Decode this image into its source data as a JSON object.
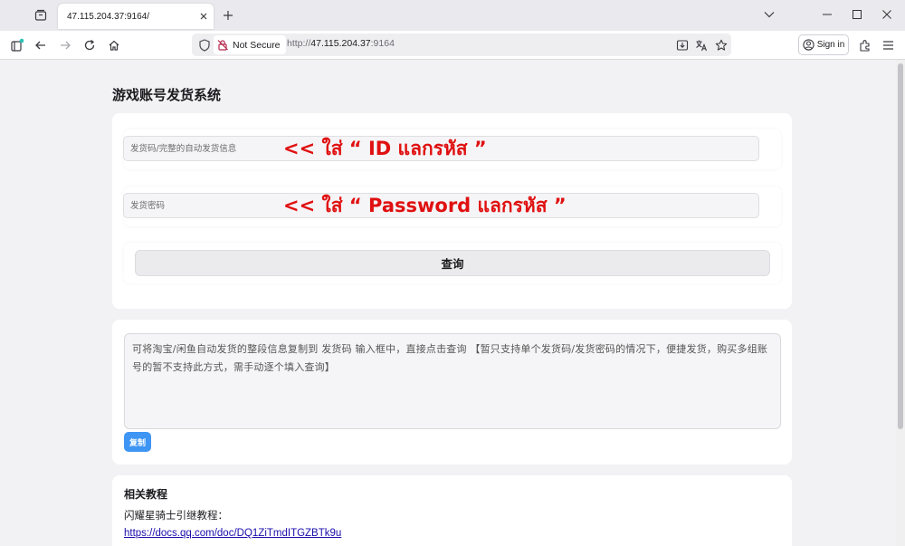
{
  "browser": {
    "tab_title": "47.115.204.37:9164/",
    "security_label": "Not Secure",
    "url_scheme": "http://",
    "url_host": "47.115.204.37",
    "url_port": ":9164",
    "signin_label": "Sign in"
  },
  "icons": {
    "tab_list": "tab-list-icon",
    "tab_close": "close-icon",
    "new_tab": "plus-icon",
    "minimize": "minimize-icon",
    "maximize": "maximize-icon",
    "window_close": "close-icon",
    "sidebar": "sidebar-icon",
    "back": "arrow-left-icon",
    "forward": "arrow-right-icon",
    "reload": "reload-icon",
    "home": "home-icon",
    "shield": "shield-icon",
    "insecure_lock": "insecure-lock-icon",
    "download": "download-icon",
    "translate": "translate-icon",
    "bookmark": "star-icon",
    "account": "account-icon",
    "extensions": "puzzle-icon",
    "menu": "hamburger-menu-icon"
  },
  "page": {
    "title": "游戏账号发货系统",
    "form": {
      "code_placeholder": "发货码/完整的自动发货信息",
      "code_annotation": "<< ใส่ “ ID แลกรหัส ”",
      "password_placeholder": "发货密码",
      "password_annotation": "<< ใส่ “ Password แลกรหัส ”",
      "query_button": "查询"
    },
    "copy_box": {
      "text": "可将淘宝/闲鱼自动发货的整段信息复制到 发货码 输入框中，直接点击查询 【暂只支持单个发货码/发货密码的情况下，便捷发货，购买多组账号的暂不支持此方式，需手动逐个填入查询】",
      "copy_button": "复制"
    },
    "tutorial": {
      "heading": "相关教程",
      "label": "闪耀星骑士引继教程：",
      "link": "https://docs.qq.com/doc/DQ1ZiTmdITGZBTk9u"
    }
  },
  "colors": {
    "annotation_red": "#e01010",
    "copy_button_blue": "#3e95f4",
    "link_blue": "#1a0dab",
    "page_background": "#f2f2f5"
  }
}
